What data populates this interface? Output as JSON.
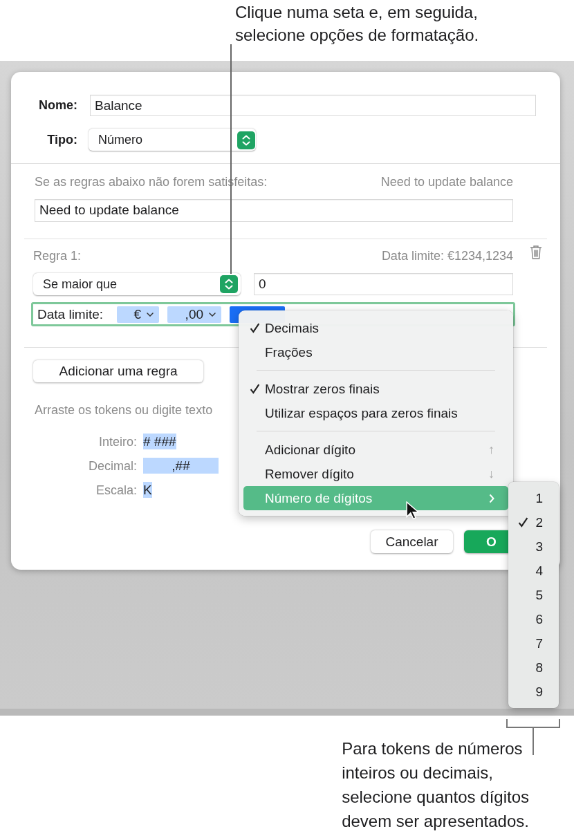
{
  "top_callout": {
    "lines": [
      "Clique numa seta e, em seguida,",
      "selecione opções de formatação."
    ]
  },
  "dialog": {
    "name_label": "Nome:",
    "name_value": "Balance",
    "type_label": "Tipo:",
    "type_value": "Número",
    "unmet_label": "Se as regras abaixo não forem satisfeitas:",
    "unmet_preview": "Need to update balance",
    "unmet_value": "Need to update balance",
    "rule": {
      "title": "Regra 1:",
      "preview": "Data limite: €1234,1234",
      "condition": "Se maior que",
      "value": "0",
      "format_label": "Data limite:",
      "tokens": [
        {
          "text": "€",
          "selected": false
        },
        {
          "text": ",00",
          "selected": false
        },
        {
          "selected": true
        }
      ]
    },
    "add_rule": "Adicionar uma regra",
    "hint": "Arraste os tokens ou digite texto",
    "token_rows": [
      {
        "label": "Inteiro:",
        "token": "# ###"
      },
      {
        "label": "Decimal:",
        "token": ",##"
      },
      {
        "label": "Escala:",
        "token": "K"
      }
    ],
    "cancel": "Cancelar",
    "ok": "O"
  },
  "menu": {
    "items": [
      {
        "kind": "item",
        "label": "Decimais",
        "checked": true,
        "selected": false
      },
      {
        "kind": "item",
        "label": "Frações",
        "checked": false,
        "selected": false
      },
      {
        "kind": "separator"
      },
      {
        "kind": "item",
        "label": "Mostrar zeros finais",
        "checked": true,
        "selected": false
      },
      {
        "kind": "item",
        "label": "Utilizar espaços para zeros finais",
        "checked": false,
        "selected": false
      },
      {
        "kind": "separator"
      },
      {
        "kind": "item",
        "label": "Adicionar dígito",
        "checked": false,
        "selected": false,
        "shortcut": "↑"
      },
      {
        "kind": "item",
        "label": "Remover dígito",
        "checked": false,
        "selected": false,
        "shortcut": "↓"
      },
      {
        "kind": "submenu",
        "label": "Número de dígitos",
        "checked": false,
        "selected": true
      }
    ]
  },
  "submenu": {
    "items": [
      {
        "label": "1",
        "checked": false
      },
      {
        "label": "2",
        "checked": true
      },
      {
        "label": "3",
        "checked": false
      },
      {
        "label": "4",
        "checked": false
      },
      {
        "label": "5",
        "checked": false
      },
      {
        "label": "6",
        "checked": false
      },
      {
        "label": "7",
        "checked": false
      },
      {
        "label": "8",
        "checked": false
      },
      {
        "label": "9",
        "checked": false
      }
    ]
  },
  "bottom_callout": {
    "lines": [
      "Para tokens de números",
      "inteiros ou decimais,",
      "selecione quantos dígitos",
      "devem ser apresentados."
    ]
  }
}
